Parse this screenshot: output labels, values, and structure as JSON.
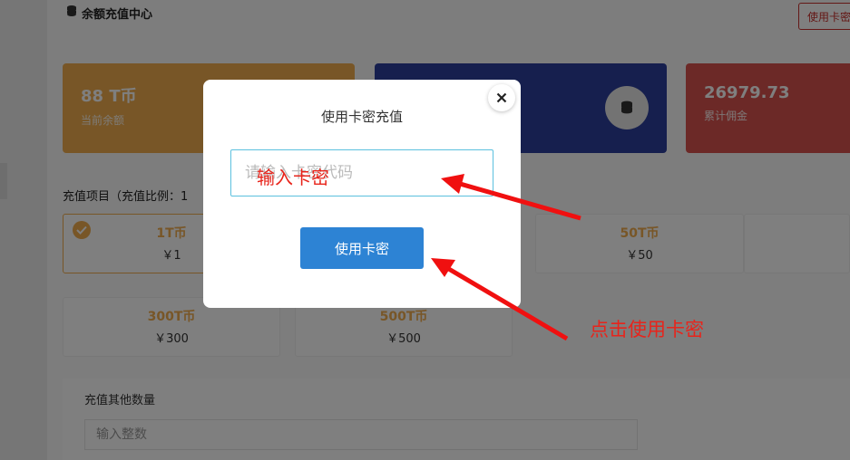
{
  "page": {
    "title": "余额充值中心",
    "header_button": "使用卡密"
  },
  "stats": [
    {
      "value": "88 T币",
      "label": "当前余额"
    },
    {
      "value": "",
      "label": ""
    },
    {
      "value": "26979.73",
      "label": "累计佣金"
    }
  ],
  "section_label": "充值项目（充值比例：1",
  "packages": [
    {
      "coins": "1T币",
      "price": "￥1",
      "selected": true
    },
    {
      "coins": "50T币",
      "price": "￥50",
      "selected": false
    },
    {
      "coins": "300T币",
      "price": "￥300",
      "selected": false
    },
    {
      "coins": "500T币",
      "price": "￥500",
      "selected": false
    }
  ],
  "other": {
    "label": "充值其他数量",
    "placeholder": "输入整数"
  },
  "modal": {
    "title": "使用卡密充值",
    "input_placeholder": "请输入卡密代码",
    "button": "使用卡密"
  },
  "annotations": {
    "input_hint": "输入卡密",
    "button_hint": "点击使用卡密",
    "color": "#e8241b"
  },
  "colors": {
    "gold": "#f0ad4e",
    "navy": "#2c3e9c",
    "red": "#d9534f",
    "primary_button": "#2d83d4"
  }
}
